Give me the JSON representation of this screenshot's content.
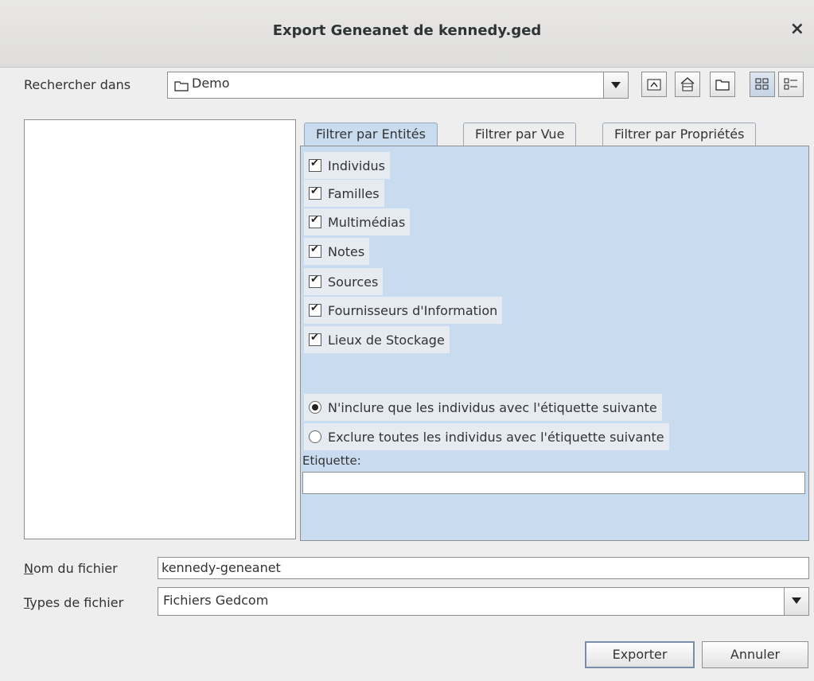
{
  "window": {
    "title": "Export Geneanet de kennedy.ged",
    "close_glyph": "×"
  },
  "lookin": {
    "label": "Rechercher dans",
    "value": "Demo"
  },
  "toolbar": {
    "icons": [
      "up-folder-icon",
      "home-icon",
      "new-folder-icon",
      "list-view-icon",
      "details-view-icon"
    ]
  },
  "tabs": [
    {
      "label": "Filtrer par Entités",
      "selected": true
    },
    {
      "label": "Filtrer par Vue",
      "selected": false
    },
    {
      "label": "Filtrer par Propriétés",
      "selected": false
    }
  ],
  "entities": [
    {
      "label": "Individus",
      "checked": true
    },
    {
      "label": "Familles",
      "checked": true
    },
    {
      "label": "Multimédias",
      "checked": true
    },
    {
      "label": "Notes",
      "checked": true
    },
    {
      "label": "Sources",
      "checked": true
    },
    {
      "label": "Fournisseurs d'Information",
      "checked": true
    },
    {
      "label": "Lieux de Stockage",
      "checked": true
    }
  ],
  "radios": [
    {
      "label": "N'inclure que les individus avec l'étiquette suivante",
      "selected": true
    },
    {
      "label": "Exclure toutes les individus avec l'étiquette suivante",
      "selected": false
    }
  ],
  "tag": {
    "label": "Etiquette:",
    "value": ""
  },
  "filename": {
    "label_mnemonic": "N",
    "label_rest": "om du fichier",
    "value": "kennedy-geneanet"
  },
  "filetype": {
    "label_mnemonic": "T",
    "label_rest": "ypes de fichier",
    "value": "Fichiers Gedcom"
  },
  "buttons": {
    "export": "Exporter",
    "cancel": "Annuler"
  }
}
